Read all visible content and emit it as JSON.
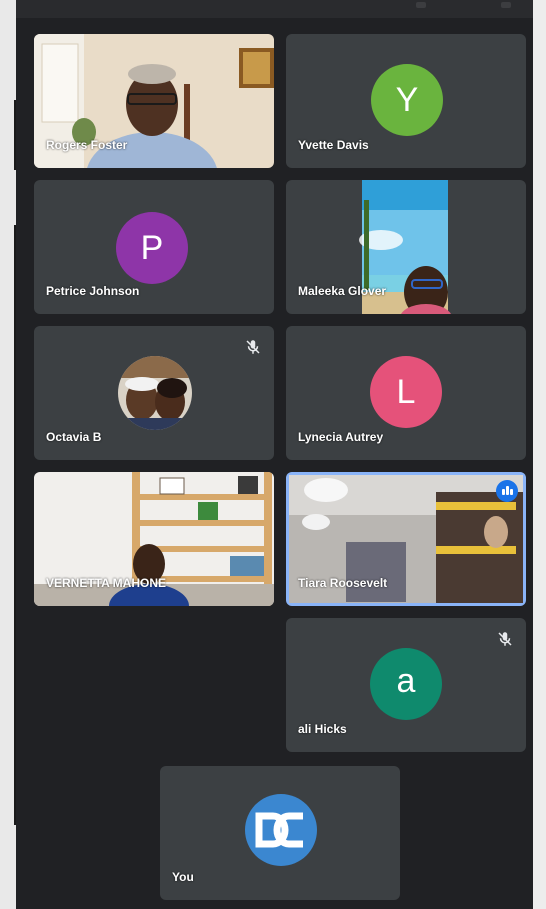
{
  "participants": [
    {
      "name": "Rogers Foster",
      "type": "video"
    },
    {
      "name": "Yvette Davis",
      "type": "avatar",
      "initial": "Y",
      "color": "#6ab43e"
    },
    {
      "name": "Petrice Johnson",
      "type": "avatar",
      "initial": "P",
      "color": "#8e35a8"
    },
    {
      "name": "Maleeka Glover",
      "type": "video"
    },
    {
      "name": "Octavia B",
      "type": "photo",
      "muted": true
    },
    {
      "name": "Lynecia Autrey",
      "type": "avatar",
      "initial": "L",
      "color": "#e5527a"
    },
    {
      "name": "VERNETTA MAHONE",
      "type": "video"
    },
    {
      "name": "Tiara Roosevelt",
      "type": "video",
      "speaking": true
    },
    {
      "name": "ali Hicks",
      "type": "avatar",
      "initial": "a",
      "color": "#0f8a6d",
      "muted": true
    },
    {
      "name": "You",
      "type": "logo"
    }
  ],
  "colors": {
    "background": "#202124",
    "tile": "#3c4043",
    "speaking_border": "#8ab4f8",
    "speaking_badge": "#1a73e8",
    "you_logo": "#3b87d0"
  },
  "icons": [
    "mic-off-icon",
    "speaking-indicator-icon"
  ]
}
